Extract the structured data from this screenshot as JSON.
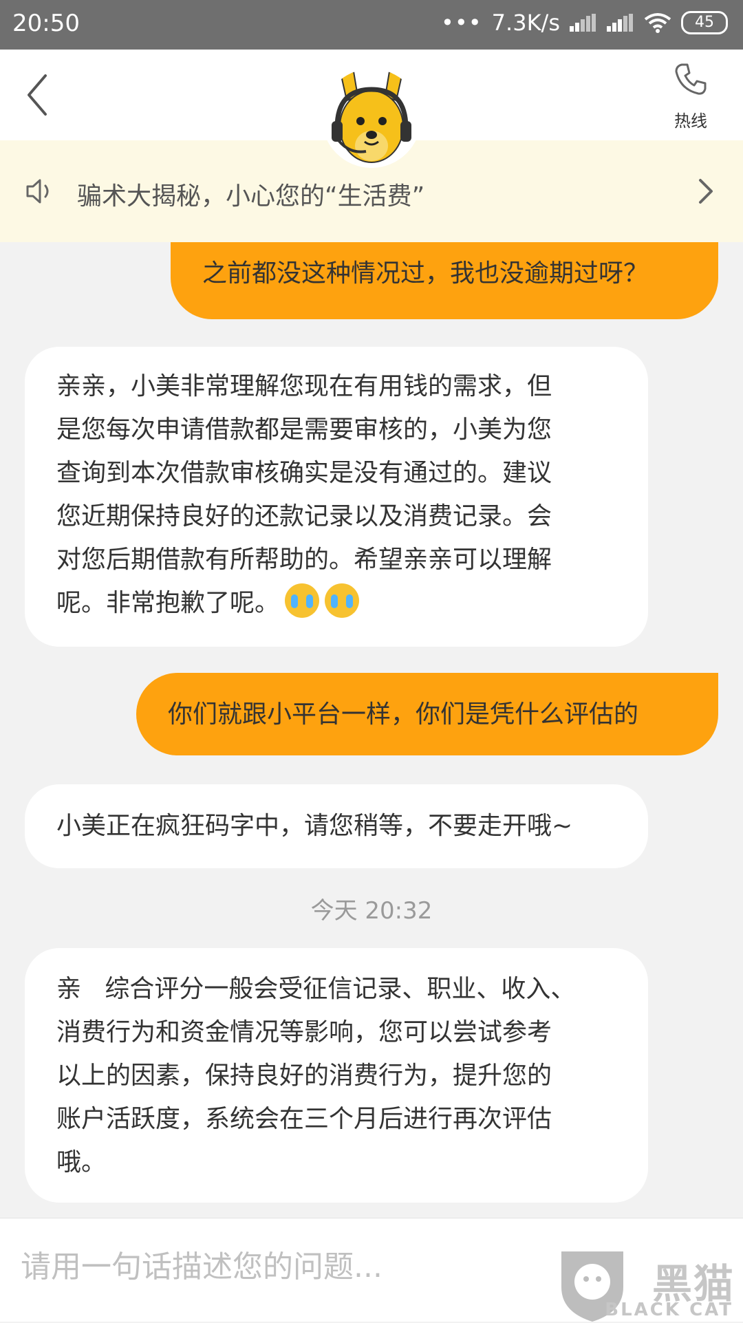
{
  "status_bar": {
    "time": "20:50",
    "dots": "•••",
    "speed": "7.3K/s",
    "battery": "45"
  },
  "header": {
    "hotline_label": "热线",
    "avatar_icon": "kangaroo-mascot-icon"
  },
  "notice": {
    "text": "骗术大揭秘，小心您的“生活费”"
  },
  "messages": [
    {
      "role": "user",
      "text": "之前都没这种情况过，我也没逾期过呀？"
    },
    {
      "role": "agent",
      "text": "亲亲，小美非常理解您现在有用钱的需求，但\n是您每次申请借款都是需要审核的，小美为您\n查询到本次借款审核确实是没有通过的。建议\n您近期保持良好的还款记录以及消费记录。会\n对您后期借款有所帮助的。希望亲亲可以理解\n呢。非常抱歉了呢。",
      "emoji": [
        "crying-face-emoji",
        "crying-face-emoji"
      ]
    },
    {
      "role": "user",
      "text": "你们就跟小平台一样，你们是凭什么评估的"
    },
    {
      "role": "agent",
      "text": "小美正在疯狂码字中，请您稍等，不要走开哦~"
    },
    {
      "role": "timestamp",
      "text": "今天 20:32"
    },
    {
      "role": "agent",
      "text": "亲   综合评分一般会受征信记录、职业、收入、\n消费行为和资金情况等影响，您可以尝试参考\n以上的因素，保持良好的消费行为，提升您的\n账户活跃度，系统会在三个月后进行再次评估\n哦。"
    }
  ],
  "input": {
    "placeholder": "请用一句话描述您的问题..."
  },
  "watermark": {
    "text": "黑猫",
    "sub": "BLACK CAT"
  },
  "colors": {
    "user_bubble": "#fea20f",
    "agent_bubble": "#ffffff",
    "notice_bg": "#fdf9e4",
    "status_bar": "#6f6f6f",
    "chat_bg": "#f2f2f2"
  }
}
